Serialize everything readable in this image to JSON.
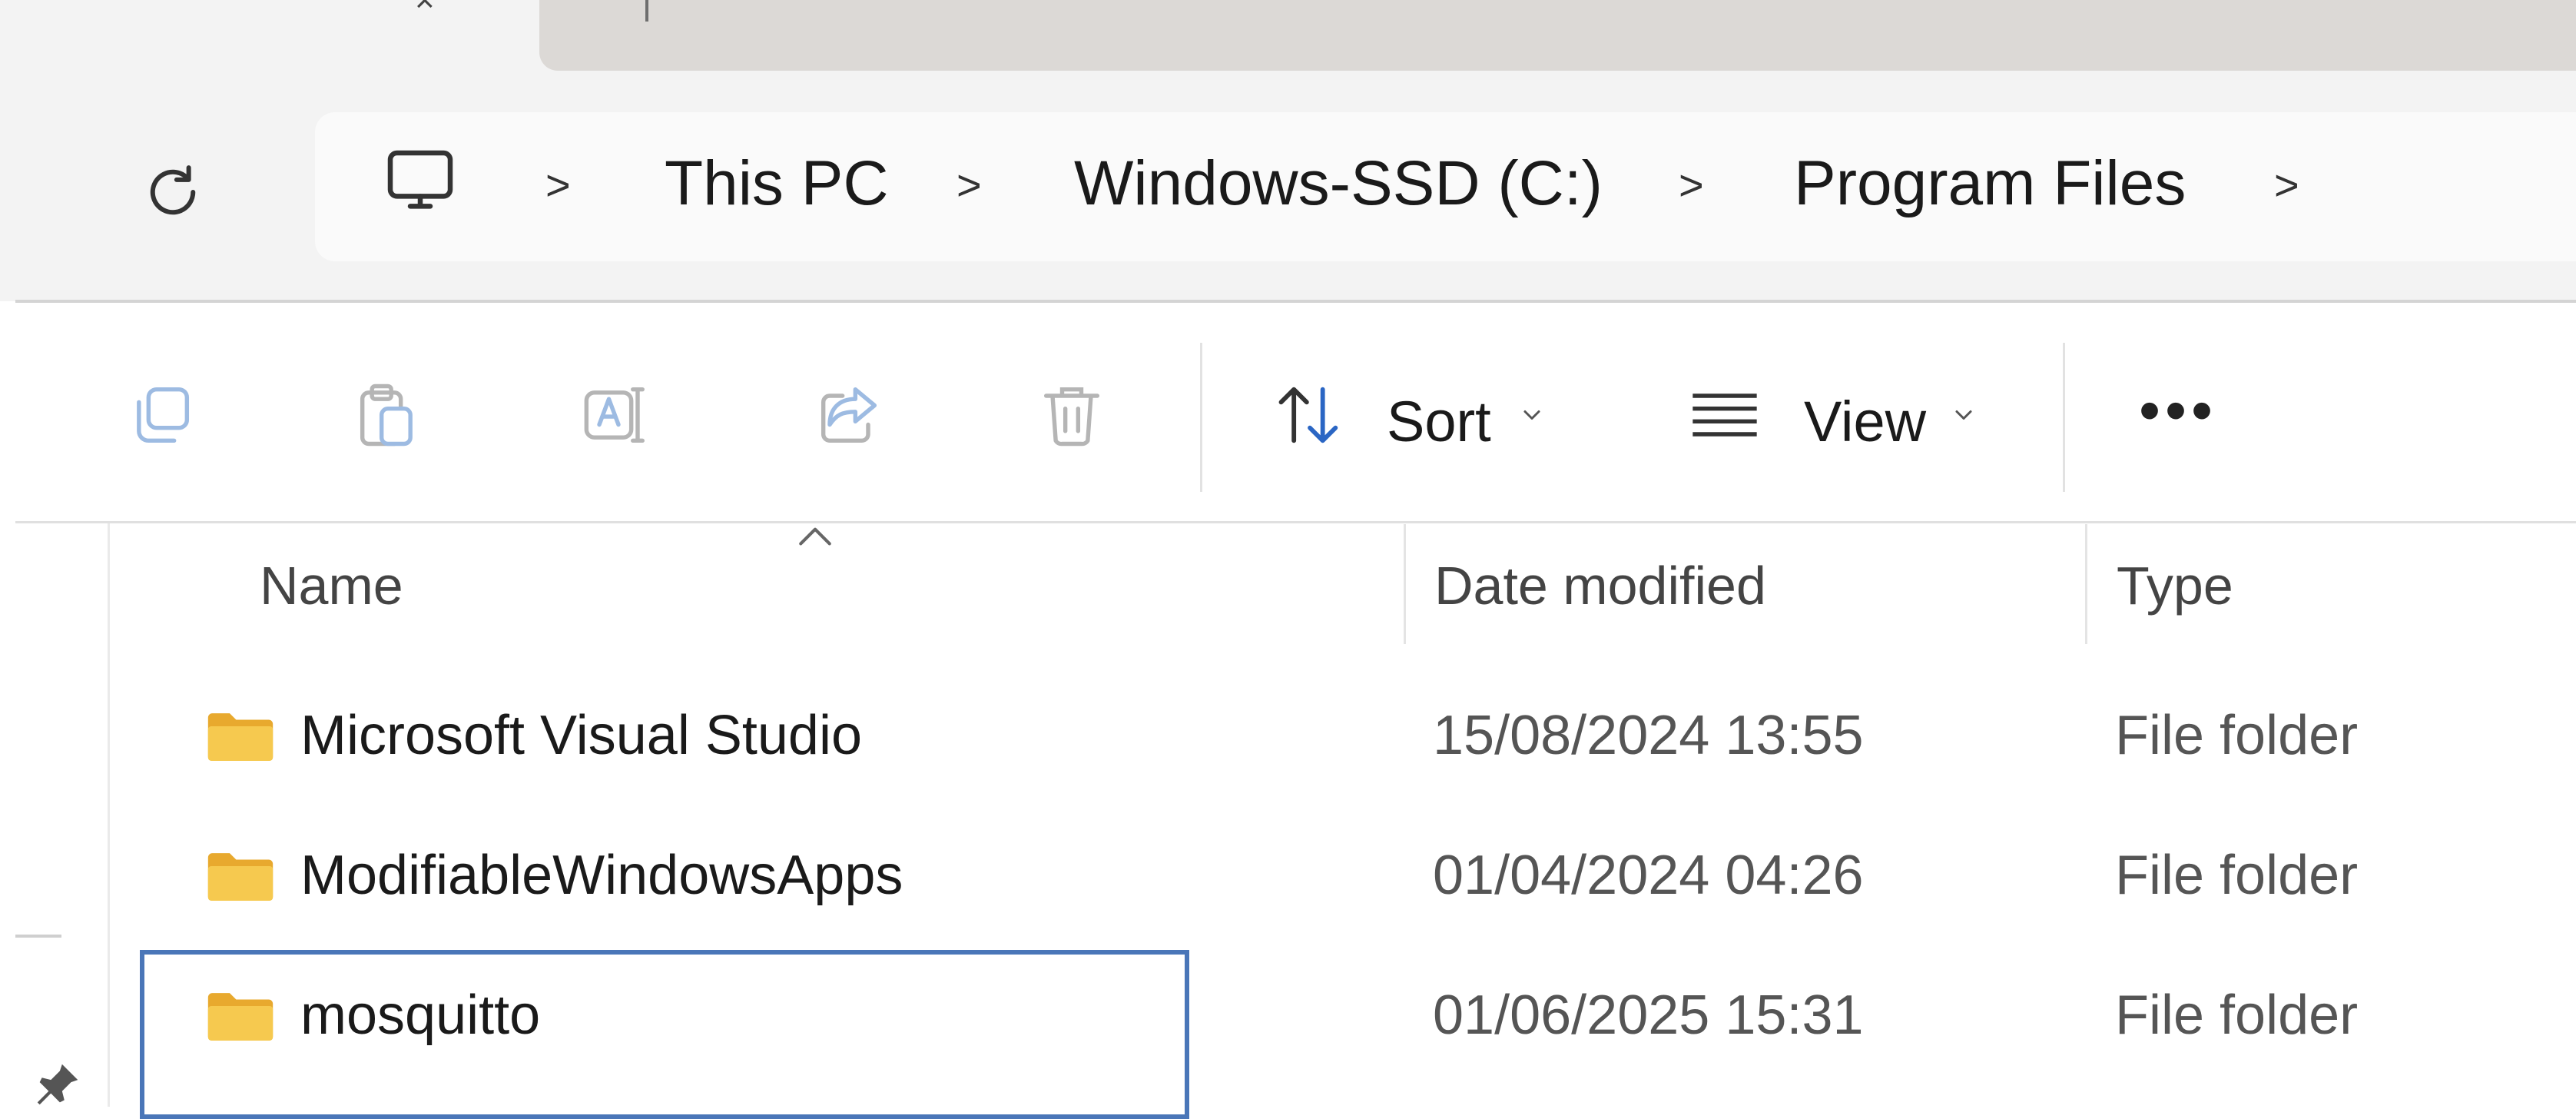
{
  "address_bar": {
    "breadcrumbs": [
      {
        "label": "This PC"
      },
      {
        "label": "Windows-SSD (C:)"
      },
      {
        "label": "Program Files"
      }
    ],
    "separator": ">"
  },
  "command_bar": {
    "icons": [
      "copy-icon",
      "paste-icon",
      "rename-icon",
      "share-icon",
      "delete-icon"
    ],
    "sort_label": "Sort",
    "view_label": "View",
    "more_label": "•••"
  },
  "file_list": {
    "columns": {
      "name": "Name",
      "date_modified": "Date modified",
      "type": "Type"
    },
    "rows": [
      {
        "name": "Microsoft Visual Studio",
        "date_modified": "15/08/2024 13:55",
        "type": "File folder"
      },
      {
        "name": "ModifiableWindowsApps",
        "date_modified": "01/04/2024 04:26",
        "type": "File folder"
      },
      {
        "name": "mosquitto",
        "date_modified": "01/06/2025 15:31",
        "type": "File folder",
        "focused": true
      }
    ]
  },
  "colors": {
    "folder": "#f2c14e",
    "focus_border": "#4a76b8",
    "chrome_bg": "#f3f3f3"
  }
}
